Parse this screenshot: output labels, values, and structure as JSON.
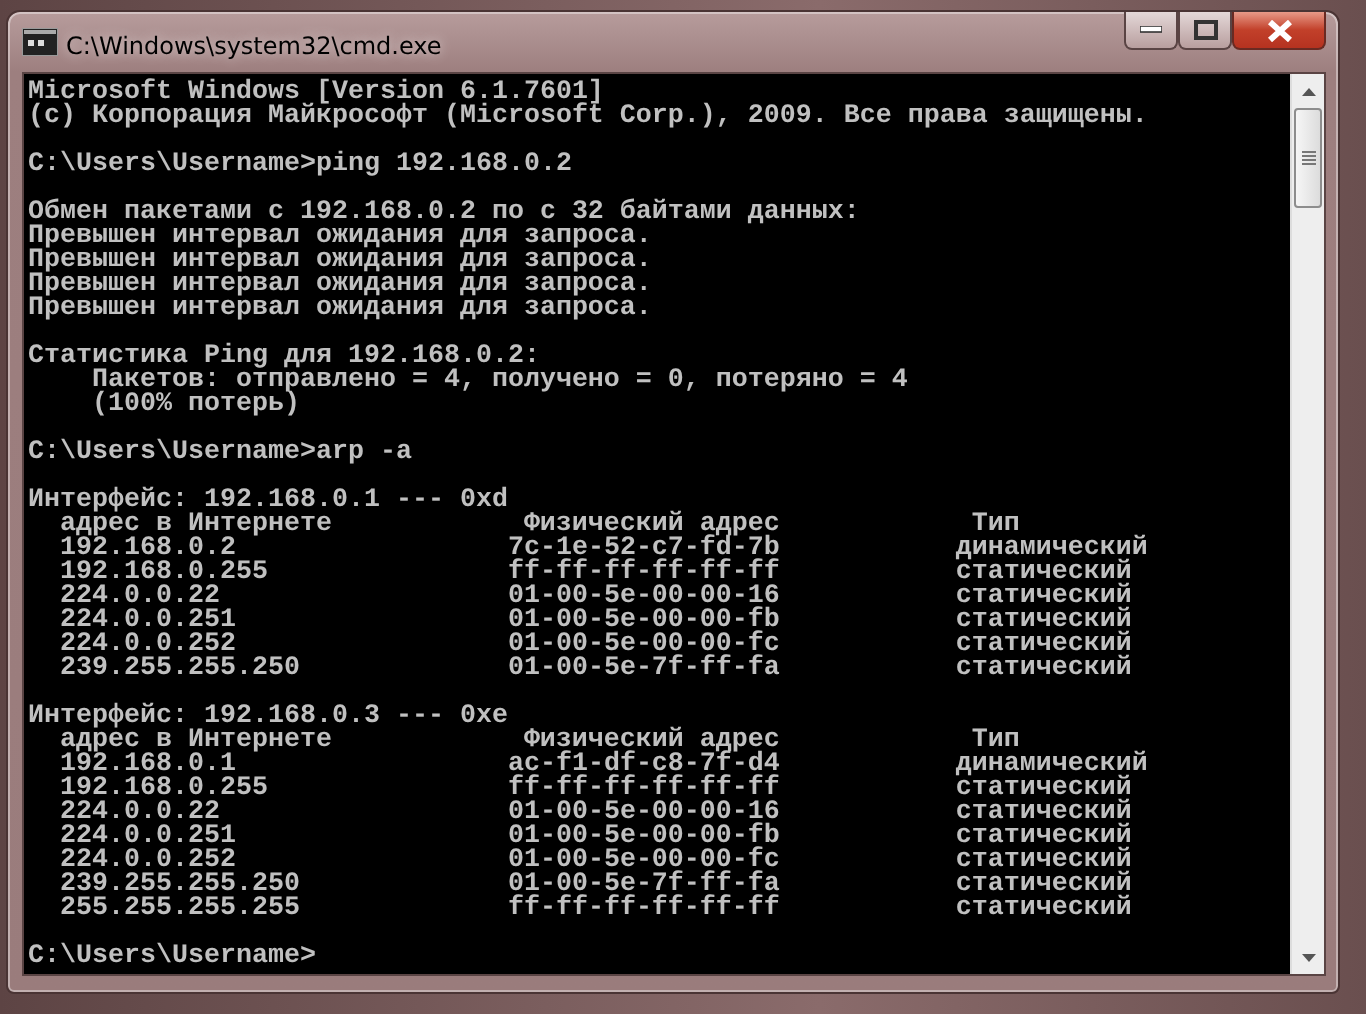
{
  "window": {
    "title": "C:\\Windows\\system32\\cmd.exe"
  },
  "console": {
    "blocks": [
      {
        "kind": "text",
        "lines": [
          "Microsoft Windows [Version 6.1.7601]",
          "(c) Корпорация Майкрософт (Microsoft Corp.), 2009. Все права защищены."
        ]
      },
      {
        "kind": "text",
        "lines": [
          "C:\\Users\\Username>ping 192.168.0.2"
        ]
      },
      {
        "kind": "text",
        "lines": [
          "Обмен пакетами с 192.168.0.2 по с 32 байтами данных:",
          "Превышен интервал ожидания для запроса.",
          "Превышен интервал ожидания для запроса.",
          "Превышен интервал ожидания для запроса.",
          "Превышен интервал ожидания для запроса."
        ]
      },
      {
        "kind": "text",
        "lines": [
          "Статистика Ping для 192.168.0.2:",
          "    Пакетов: отправлено = 4, получено = 0, потеряно = 4",
          "    (100% потерь)"
        ]
      },
      {
        "kind": "text",
        "lines": [
          "C:\\Users\\Username>arp -a"
        ]
      },
      {
        "kind": "arp",
        "interface": "Интерфейс: 192.168.0.1 --- 0xd",
        "columns": [
          "адрес в Интернете",
          "Физический адрес",
          "Тип"
        ],
        "rows": [
          [
            "192.168.0.2",
            "7c-1e-52-c7-fd-7b",
            "динамический"
          ],
          [
            "192.168.0.255",
            "ff-ff-ff-ff-ff-ff",
            "статический"
          ],
          [
            "224.0.0.22",
            "01-00-5e-00-00-16",
            "статический"
          ],
          [
            "224.0.0.251",
            "01-00-5e-00-00-fb",
            "статический"
          ],
          [
            "224.0.0.252",
            "01-00-5e-00-00-fc",
            "статический"
          ],
          [
            "239.255.255.250",
            "01-00-5e-7f-ff-fa",
            "статический"
          ]
        ]
      },
      {
        "kind": "arp",
        "interface": "Интерфейс: 192.168.0.3 --- 0xe",
        "columns": [
          "адрес в Интернете",
          "Физический адрес",
          "Тип"
        ],
        "rows": [
          [
            "192.168.0.1",
            "ac-f1-df-c8-7f-d4",
            "динамический"
          ],
          [
            "192.168.0.255",
            "ff-ff-ff-ff-ff-ff",
            "статический"
          ],
          [
            "224.0.0.22",
            "01-00-5e-00-00-16",
            "статический"
          ],
          [
            "224.0.0.251",
            "01-00-5e-00-00-fb",
            "статический"
          ],
          [
            "224.0.0.252",
            "01-00-5e-00-00-fc",
            "статический"
          ],
          [
            "239.255.255.250",
            "01-00-5e-7f-ff-fa",
            "статический"
          ],
          [
            "255.255.255.255",
            "ff-ff-ff-ff-ff-ff",
            "статический"
          ]
        ]
      },
      {
        "kind": "text",
        "lines": [
          "C:\\Users\\Username>"
        ]
      }
    ]
  }
}
